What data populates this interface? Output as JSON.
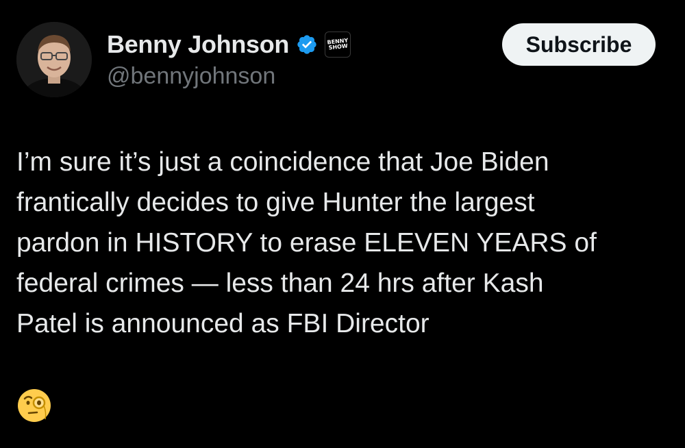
{
  "author": {
    "display_name": "Benny Johnson",
    "handle": "@bennyjohnson",
    "verified_icon": "verified-badge-icon",
    "affiliate_badge_text": "BENNY\nSHOW"
  },
  "actions": {
    "subscribe_label": "Subscribe"
  },
  "tweet": {
    "lines": [
      "I’m sure it’s just a coincidence that Joe Biden",
      "frantically decides to give Hunter the largest",
      "pardon in HISTORY to erase ELEVEN YEARS of",
      "federal crimes — less than 24 hrs after Kash",
      "Patel is announced as FBI Director"
    ],
    "emoji": "face-with-monocle-icon"
  },
  "colors": {
    "background": "#000000",
    "text_primary": "#e7e9ea",
    "text_secondary": "#71767b",
    "verified_blue": "#1d9bf0",
    "button_bg": "#eff3f4"
  }
}
